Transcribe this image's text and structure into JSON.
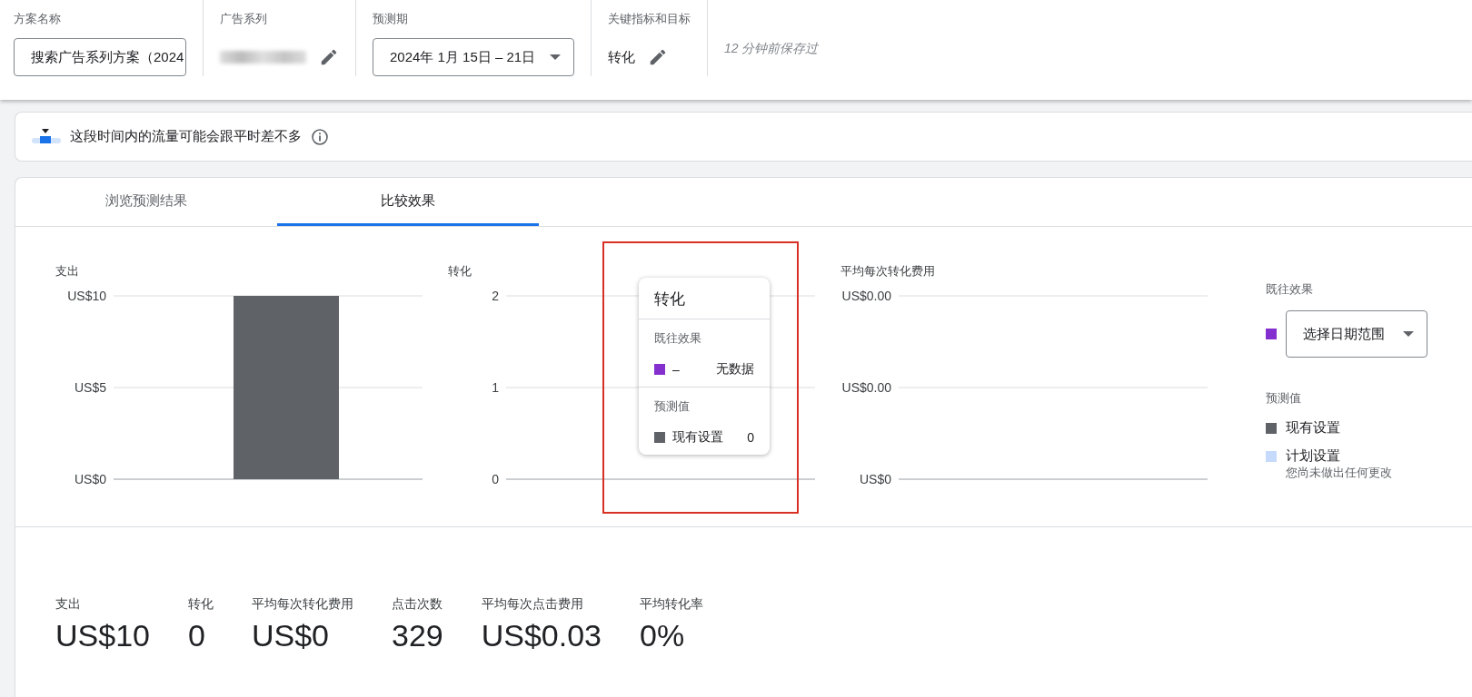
{
  "header": {
    "fields": [
      {
        "kind": "input",
        "label": "方案名称",
        "value": "搜索广告系列方案（2024"
      },
      {
        "kind": "redacted",
        "label": "广告系列"
      },
      {
        "kind": "dropdown",
        "label": "预测期",
        "value": "2024年 1月 15日 – 21日"
      },
      {
        "kind": "editable",
        "label": "关键指标和目标",
        "value": "转化"
      }
    ],
    "saved_note": "12 分钟前保存过"
  },
  "notice": {
    "text": "这段时间内的流量可能会跟平时差不多"
  },
  "tabs": [
    {
      "label": "浏览预测结果",
      "selected": false
    },
    {
      "label": "比较效果",
      "selected": true
    }
  ],
  "charts": [
    {
      "kind": "bar",
      "title": "支出",
      "axis_labels": [
        "US$10",
        "US$5",
        "US$0"
      ]
    },
    {
      "kind": "empty",
      "title": "转化",
      "axis_labels": [
        "2",
        "1",
        "0"
      ]
    },
    {
      "kind": "empty",
      "title": "平均每次转化费用",
      "axis_labels": [
        "US$0.00",
        "US$0.00",
        "US$0"
      ]
    }
  ],
  "tooltip": {
    "title": "转化",
    "sections": [
      {
        "heading": "既往效果",
        "rows": [
          {
            "label": "–",
            "value": "无数据",
            "color": "#8430ce"
          }
        ]
      },
      {
        "heading": "预测值",
        "rows": [
          {
            "label": "现有设置",
            "value": "0",
            "color": "#5f6368"
          }
        ]
      }
    ]
  },
  "legend": {
    "historical": {
      "heading": "既往效果",
      "color": "#8430ce",
      "dropdown": "选择日期范围"
    },
    "forecast": {
      "heading": "预测值",
      "items": [
        {
          "label": "现有设置",
          "color": "#5f6368"
        },
        {
          "label": "计划设置",
          "color": "#c6dafc",
          "note": "您尚未做出任何更改"
        }
      ]
    }
  },
  "stats": [
    {
      "label": "支出",
      "value": "US$10"
    },
    {
      "label": "转化",
      "value": "0"
    },
    {
      "label": "平均每次转化费用",
      "value": "US$0"
    },
    {
      "label": "点击次数",
      "value": "329"
    },
    {
      "label": "平均每次点击费用",
      "value": "US$0.03"
    },
    {
      "label": "平均转化率",
      "value": "0%"
    }
  ]
}
